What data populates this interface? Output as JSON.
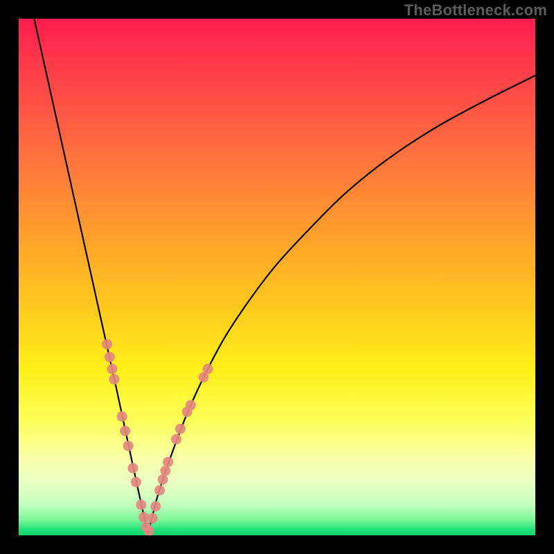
{
  "watermark_text": "TheBottleneck.com",
  "chart_data": {
    "type": "line",
    "title": "",
    "xlabel": "",
    "ylabel": "",
    "xlim": [
      0,
      100
    ],
    "ylim": [
      0,
      100
    ],
    "grid": false,
    "legend": false,
    "series": [
      {
        "name": "bottleneck-curve",
        "x": [
          3,
          5,
          7,
          9,
          11,
          13,
          15,
          17,
          19,
          20.5,
          22,
          23.3,
          24.3,
          25,
          25.7,
          27,
          29,
          31,
          33,
          36,
          40,
          45,
          50,
          56,
          63,
          71,
          80,
          90,
          100
        ],
        "y": [
          100,
          91,
          82,
          73,
          64,
          55,
          46,
          37,
          28,
          21,
          14,
          8,
          3.5,
          0.5,
          3,
          8,
          14,
          19.5,
          24.5,
          31,
          38.5,
          46,
          52.5,
          59,
          66,
          72.5,
          78.5,
          84,
          89
        ]
      }
    ],
    "markers": [
      {
        "name": "highlight-dots-left",
        "color": "#e4887e",
        "points": [
          {
            "x": 17.1,
            "y": 37
          },
          {
            "x": 17.6,
            "y": 34.5
          },
          {
            "x": 18.1,
            "y": 32.2
          },
          {
            "x": 18.5,
            "y": 30.2
          },
          {
            "x": 20.0,
            "y": 23
          },
          {
            "x": 20.6,
            "y": 20.2
          },
          {
            "x": 21.2,
            "y": 17.3
          },
          {
            "x": 22.1,
            "y": 13
          },
          {
            "x": 22.7,
            "y": 10.3
          },
          {
            "x": 23.7,
            "y": 5.9
          },
          {
            "x": 24.2,
            "y": 3.5
          },
          {
            "x": 24.7,
            "y": 1.6
          }
        ]
      },
      {
        "name": "highlight-dots-bottom",
        "color": "#e4887e",
        "points": [
          {
            "x": 25.2,
            "y": 0.8
          },
          {
            "x": 25.9,
            "y": 3.3
          },
          {
            "x": 26.5,
            "y": 5.6
          }
        ]
      },
      {
        "name": "highlight-dots-right",
        "color": "#e4887e",
        "points": [
          {
            "x": 27.3,
            "y": 8.7
          },
          {
            "x": 27.9,
            "y": 10.8
          },
          {
            "x": 28.4,
            "y": 12.5
          },
          {
            "x": 28.9,
            "y": 14.2
          },
          {
            "x": 30.5,
            "y": 18.6
          },
          {
            "x": 31.3,
            "y": 20.6
          },
          {
            "x": 32.6,
            "y": 23.9
          },
          {
            "x": 33.3,
            "y": 25.2
          },
          {
            "x": 35.8,
            "y": 30.6
          },
          {
            "x": 36.6,
            "y": 32.2
          }
        ]
      }
    ],
    "annotations": [
      {
        "text": "TheBottleneck.com",
        "position": "top-right"
      }
    ],
    "colors": {
      "curve": "#000000",
      "marker": "#e4887e",
      "background_top": "#ff1d4e",
      "background_mid": "#fff019",
      "background_bottom": "#10d66e",
      "frame": "#000000"
    }
  }
}
